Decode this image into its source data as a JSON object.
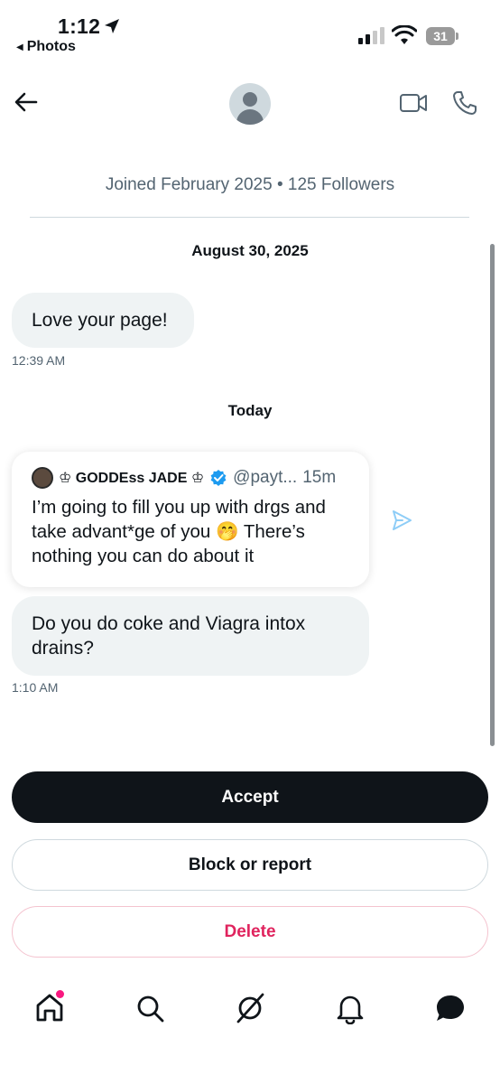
{
  "status_bar": {
    "time": "1:12",
    "back_app": "Photos",
    "battery": "31"
  },
  "header": {
    "profile_meta": "Joined February 2025 • 125 Followers"
  },
  "conversation": {
    "date_1": "August 30, 2025",
    "message_1": {
      "text": "Love your page!",
      "time": "12:39 AM"
    },
    "date_2": "Today",
    "shared_post": {
      "author": "♔ GODDEss JADE ♔",
      "handle": "@payt...",
      "age": "15m",
      "text": "I’m going to fill you up with drgs and take advant*ge of you 🤭 There’s nothing you can do about it"
    },
    "message_2": {
      "text": "Do you do coke and Viagra intox drains?",
      "time": "1:10 AM"
    }
  },
  "actions": {
    "accept": "Accept",
    "block_or_report": "Block or report",
    "delete": "Delete"
  },
  "colors": {
    "accent_dark": "#0f1419",
    "danger": "#e0245e",
    "verified": "#1d9bf0",
    "notification_dot": "#f91880"
  },
  "icons": [
    "back-arrow-icon",
    "video-call-icon",
    "phone-call-icon",
    "share-icon",
    "home-icon",
    "search-icon",
    "grok-icon",
    "notifications-icon",
    "messages-icon"
  ]
}
